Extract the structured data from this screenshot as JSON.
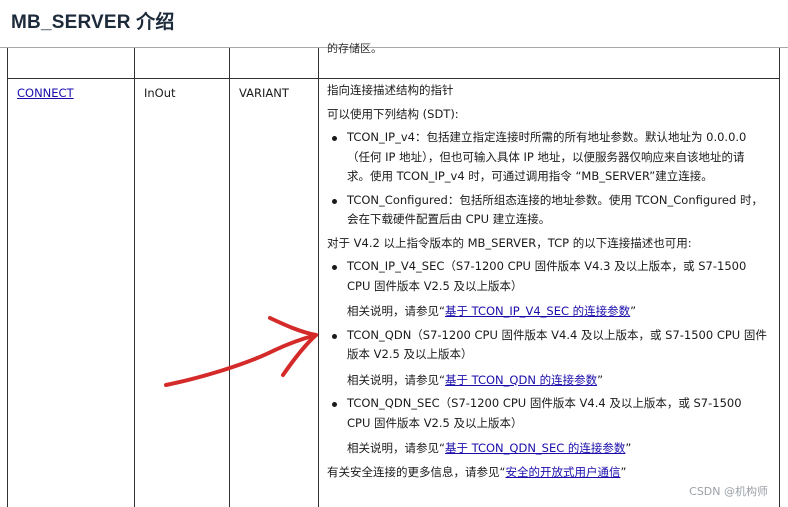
{
  "page": {
    "title": "MB_SERVER 介绍"
  },
  "table": {
    "truncated_prev_text": "的存储区。",
    "row": {
      "param_name": "CONNECT",
      "declaration": "InOut",
      "data_type": "VARIANT",
      "desc_intro": "指向连接描述结构的指针",
      "desc_sdt": "可以使用下列结构 (SDT):",
      "bullets_1": [
        {
          "text": "TCON_IP_v4：包括建立指定连接时所需的所有地址参数。默认地址为 0.0.0.0（任何 IP 地址），但也可输入具体 IP 地址，以便服务器仅响应来自该地址的请求。使用 TCON_IP_v4 时，可通过调用指令 “MB_SERVER”建立连接。"
        },
        {
          "text": "TCON_Configured：包括所组态连接的地址参数。使用 TCON_Configured 时，会在下载硬件配置后由 CPU 建立连接。"
        }
      ],
      "desc_v42": "对于 V4.2 以上指令版本的 MB_SERVER，TCP 的以下连接描述也可用:",
      "bullets_2": [
        {
          "text": "TCON_IP_V4_SEC（S7-1200 CPU 固件版本 V4.3 及以上版本，或 S7-1500 CPU 固件版本 V2.5 及以上版本）",
          "note_prefix": "相关说明，请参见“",
          "note_link": "基于 TCON_IP_V4_SEC 的连接参数",
          "note_suffix": "”"
        },
        {
          "text": "TCON_QDN（S7-1200 CPU 固件版本 V4.4 及以上版本，或 S7-1500 CPU 固件版本 V2.5 及以上版本）",
          "note_prefix": "相关说明，请参见“",
          "note_link": "基于 TCON_QDN 的连接参数",
          "note_suffix": "”"
        },
        {
          "text": "TCON_QDN_SEC（S7-1200 CPU 固件版本 V4.4 及以上版本，或 S7-1500 CPU 固件版本 V2.5 及以上版本）",
          "note_prefix": "相关说明，请参见“",
          "note_link": "基于 TCON_QDN_SEC 的连接参数",
          "note_suffix": "”"
        }
      ],
      "footer_prefix": "有关安全连接的更多信息，请参见“",
      "footer_link": "安全的开放式用户通信",
      "footer_suffix": "”"
    }
  },
  "watermark": "CSDN @机构师",
  "annotation": {
    "arrow_color": "#d42a2a"
  }
}
